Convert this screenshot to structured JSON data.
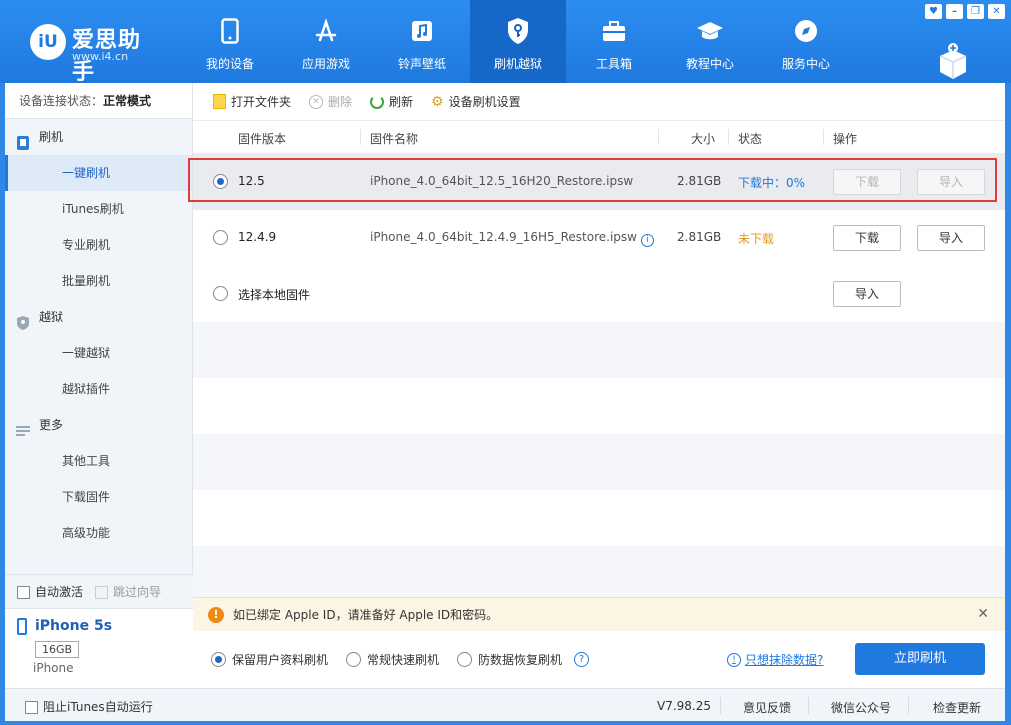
{
  "app": {
    "logo_badge": "iU",
    "logo_title": "爱思助手",
    "logo_url": "www.i4.cn",
    "window_controls": [
      "♥",
      "–",
      "❐",
      "✕"
    ]
  },
  "nav": [
    {
      "label": "我的设备",
      "icon": "phone-icon"
    },
    {
      "label": "应用游戏",
      "icon": "app-store-icon"
    },
    {
      "label": "铃声壁纸",
      "icon": "music-icon"
    },
    {
      "label": "刷机越狱",
      "icon": "shield-key-icon",
      "active": true
    },
    {
      "label": "工具箱",
      "icon": "toolbox-icon"
    },
    {
      "label": "教程中心",
      "icon": "graduation-cap-icon"
    },
    {
      "label": "服务中心",
      "icon": "compass-icon"
    }
  ],
  "sidebar": {
    "conn_label": "设备连接状态：",
    "conn_value": "正常模式",
    "groups": [
      {
        "label": "刷机",
        "items": [
          "一键刷机",
          "iTunes刷机",
          "专业刷机",
          "批量刷机"
        ]
      },
      {
        "label": "越狱",
        "items": [
          "一键越狱",
          "越狱插件"
        ]
      },
      {
        "label": "更多",
        "items": [
          "其他工具",
          "下载固件",
          "高级功能"
        ]
      }
    ],
    "auto_activate": "自动激活",
    "skip_guide": "跳过向导",
    "device": {
      "name": "iPhone 5s",
      "storage": "16GB",
      "model": "iPhone"
    }
  },
  "toolbar": {
    "open_folder": "打开文件夹",
    "delete": "删除",
    "refresh": "刷新",
    "settings": "设备刷机设置"
  },
  "table": {
    "headers": {
      "version": "固件版本",
      "name": "固件名称",
      "size": "大小",
      "status": "状态",
      "action": "操作"
    },
    "rows": [
      {
        "version": "12.5",
        "name": "iPhone_4.0_64bit_12.5_16H20_Restore.ipsw",
        "size": "2.81GB",
        "status": "下载中：0%",
        "download": "下载",
        "import": "导入"
      },
      {
        "version": "12.4.9",
        "name": "iPhone_4.0_64bit_12.4.9_16H5_Restore.ipsw",
        "size": "2.81GB",
        "status": "未下载",
        "download": "下载",
        "import": "导入"
      },
      {
        "version": "选择本地固件",
        "import": "导入"
      }
    ],
    "colors": {
      "downloading": "#1f79de",
      "not_downloaded": "#e39a16"
    }
  },
  "notice": {
    "text": "如已绑定 Apple ID，请准备好 Apple ID和密码。",
    "close": "✕"
  },
  "flash_options": {
    "options": [
      "保留用户资料刷机",
      "常规快速刷机",
      "防数据恢复刷机"
    ],
    "help": "?",
    "erase_link": "只想抹除数据?",
    "flash_button": "立即刷机"
  },
  "statusbar": {
    "itunes": "阻止iTunes自动运行",
    "version": "V7.98.25",
    "feedback": "意见反馈",
    "wechat": "微信公众号",
    "update": "检查更新"
  }
}
